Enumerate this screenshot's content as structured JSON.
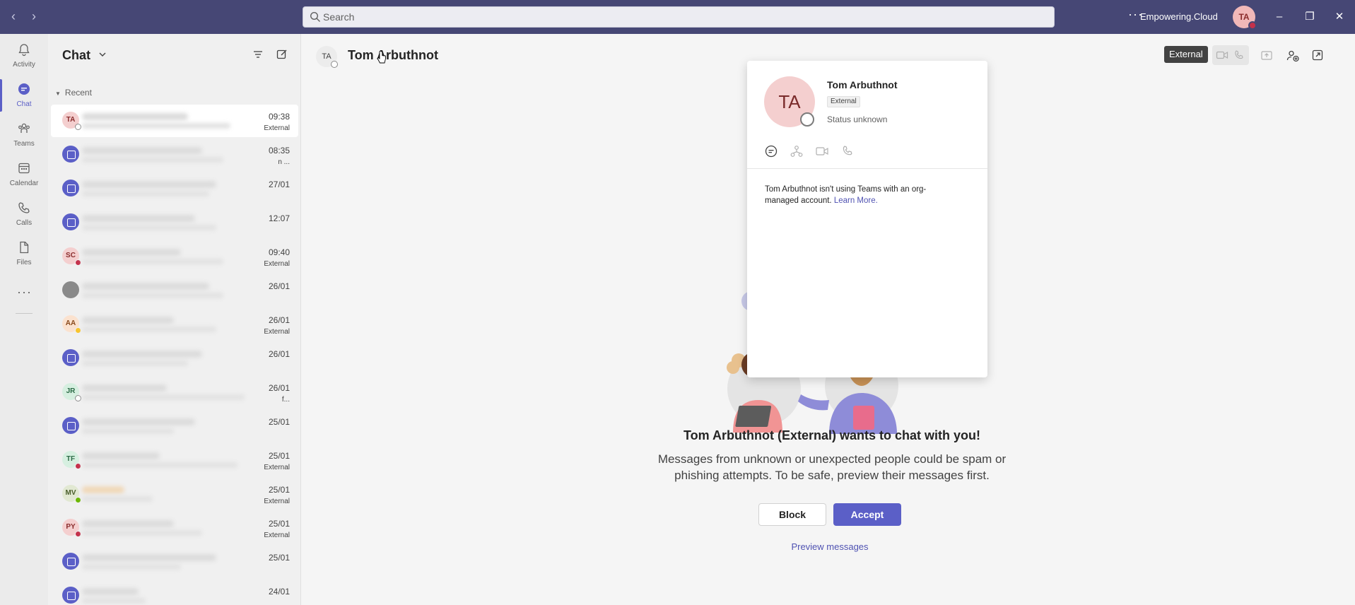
{
  "titlebar": {
    "search_placeholder": "Search",
    "org_name": "Empowering.Cloud",
    "avatar_initials": "TA",
    "more_label": "···"
  },
  "rail": {
    "items": [
      {
        "label": "Activity",
        "icon": "bell-icon"
      },
      {
        "label": "Chat",
        "icon": "chat-icon"
      },
      {
        "label": "Teams",
        "icon": "teams-icon"
      },
      {
        "label": "Calendar",
        "icon": "calendar-icon"
      },
      {
        "label": "Calls",
        "icon": "phone-icon"
      },
      {
        "label": "Files",
        "icon": "file-icon"
      }
    ],
    "more_label": "···"
  },
  "chatlist": {
    "title": "Chat",
    "section": "Recent",
    "rows": [
      {
        "initials": "TA",
        "time": "09:38",
        "sub": "External"
      },
      {
        "initials": "",
        "time": "08:35",
        "sub": "n ..."
      },
      {
        "initials": "",
        "time": "27/01",
        "sub": ""
      },
      {
        "initials": "",
        "time": "12:07",
        "sub": ""
      },
      {
        "initials": "SC",
        "time": "09:40",
        "sub": "External"
      },
      {
        "initials": "",
        "time": "26/01",
        "sub": ""
      },
      {
        "initials": "AA",
        "time": "26/01",
        "sub": "External"
      },
      {
        "initials": "",
        "time": "26/01",
        "sub": ""
      },
      {
        "initials": "JR",
        "time": "26/01",
        "sub": "f..."
      },
      {
        "initials": "",
        "time": "25/01",
        "sub": ""
      },
      {
        "initials": "TF",
        "time": "25/01",
        "sub": "External"
      },
      {
        "initials": "MV",
        "time": "25/01",
        "sub": "External"
      },
      {
        "initials": "PY",
        "time": "25/01",
        "sub": "External"
      },
      {
        "initials": "",
        "time": "25/01",
        "sub": ""
      },
      {
        "initials": "",
        "time": "24/01",
        "sub": ""
      }
    ]
  },
  "header": {
    "avatar_initials": "TA",
    "name": "Tom Arbuthnot",
    "badge": "External"
  },
  "popcard": {
    "initials": "TA",
    "name": "Tom Arbuthnot",
    "tag": "External",
    "status": "Status unknown",
    "message": "Tom Arbuthnot isn't using Teams with an org-managed account.",
    "link": "Learn More."
  },
  "request": {
    "title": "Tom Arbuthnot (External) wants to chat with you!",
    "line1": "Messages from unknown or unexpected people could be spam or",
    "line2": "phishing attempts. To be safe, preview their messages first.",
    "block_label": "Block",
    "accept_label": "Accept",
    "preview_label": "Preview messages"
  },
  "colors": {
    "titlebar": "#464775",
    "accent": "#5b5fc7",
    "busy": "#c4314b",
    "available": "#6bb700",
    "away": "#f8c42c"
  }
}
